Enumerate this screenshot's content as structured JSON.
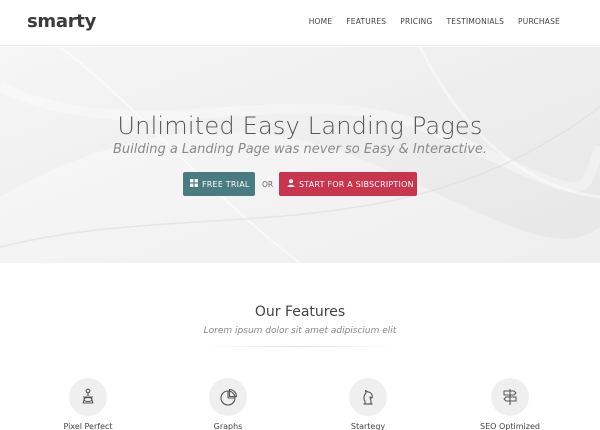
{
  "header": {
    "logo": "smarty",
    "nav": [
      "HOME",
      "FEATURES",
      "PRICING",
      "TESTIMONIALS",
      "PURCHASE"
    ]
  },
  "hero": {
    "title": "Unlimited Easy Landing Pages",
    "subtitle": "Building a Landing Page was never so Easy & Interactive.",
    "trial_button": "FREE TRIAL",
    "or_text": "OR",
    "subscribe_button": "START FOR A SIBSCRIPTION",
    "colors": {
      "trial": "#4a7b80",
      "subscribe": "#c8354d"
    }
  },
  "features": {
    "title": "Our Features",
    "subtitle": "Lorem ipsum dolor sit amet adipiscium elit",
    "items": [
      {
        "label": "Pixel Perfect",
        "icon": "pixel-perfect-icon"
      },
      {
        "label": "Graphs",
        "icon": "pie-chart-icon"
      },
      {
        "label": "Startegy",
        "icon": "chess-knight-icon"
      },
      {
        "label": "SEO Optimized",
        "icon": "signpost-icon"
      }
    ]
  }
}
